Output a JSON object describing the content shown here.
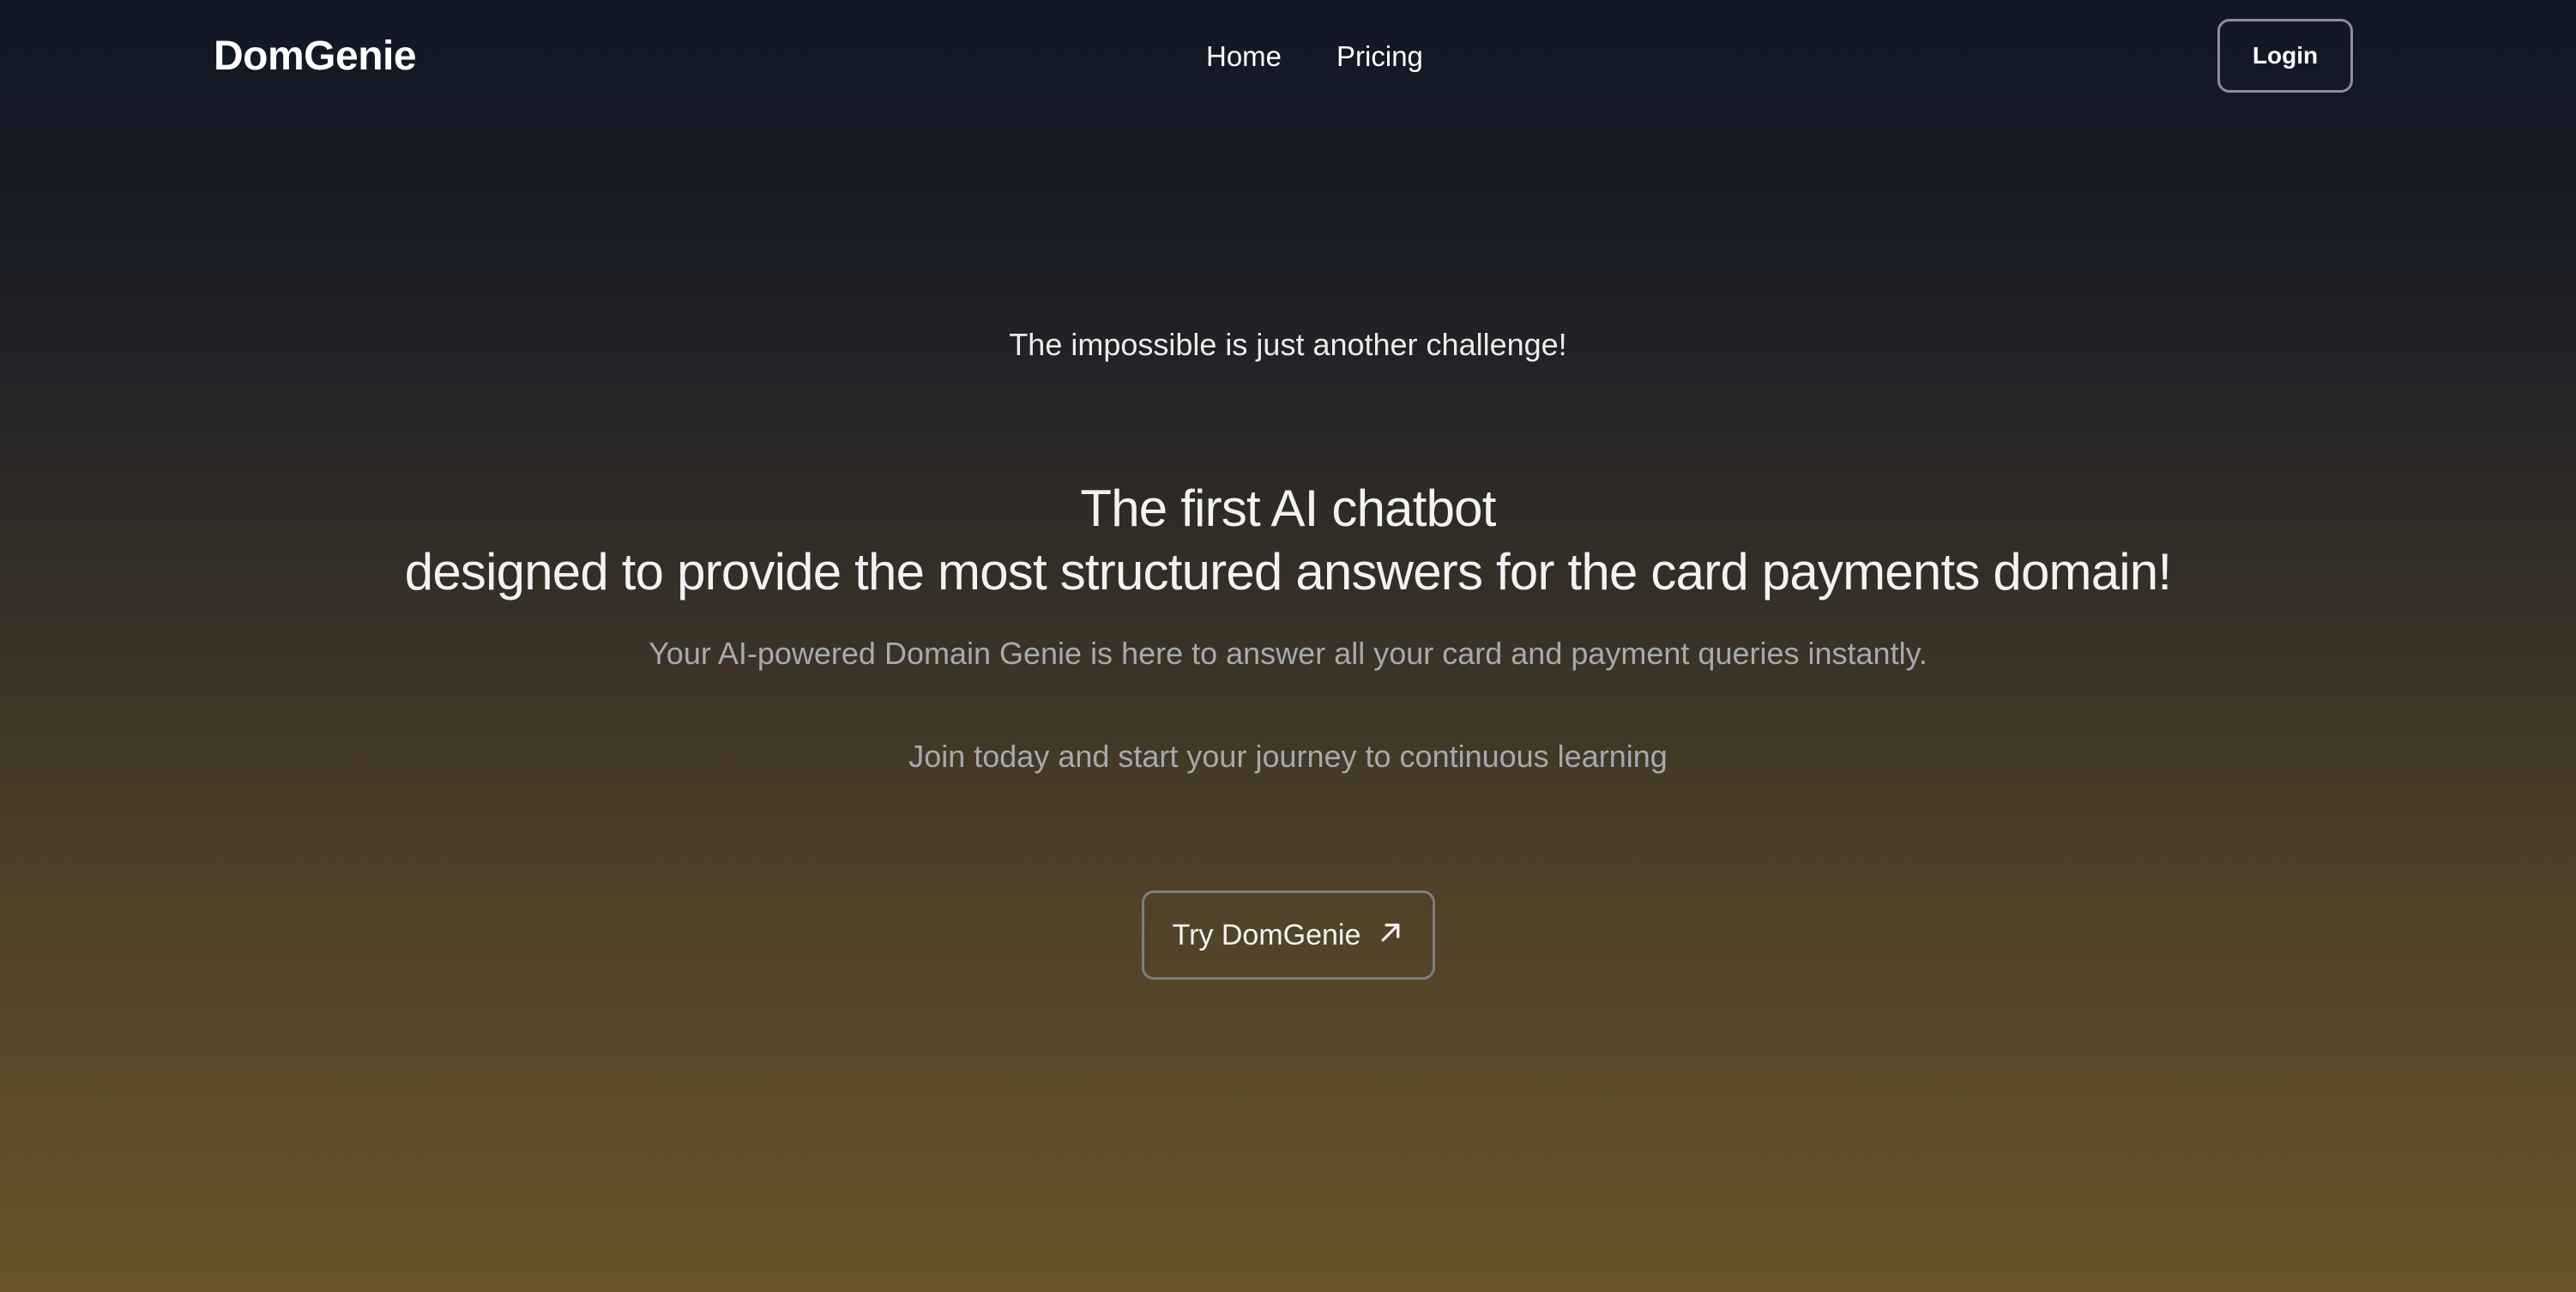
{
  "nav": {
    "brand": "DomGenie",
    "links": [
      {
        "label": "Home"
      },
      {
        "label": "Pricing"
      }
    ],
    "login_label": "Login"
  },
  "hero": {
    "tagline": "The impossible is just another challenge!",
    "headline_line1": "The first AI chatbot",
    "headline_line2": "designed to provide the most structured answers for the card payments domain!",
    "subtext": "Your AI-powered Domain Genie is here to answer all your card and payment queries instantly.",
    "join_text": "Join today and start your journey to continuous learning",
    "cta_label": "Try DomGenie",
    "cta_icon": "arrow-up-right-icon"
  },
  "colors": {
    "background_top": "#111827",
    "background_bottom": "#6a5428",
    "text_primary": "#f3f3f3",
    "text_muted": "#a7a9ad",
    "button_border": "#8a8f98"
  }
}
